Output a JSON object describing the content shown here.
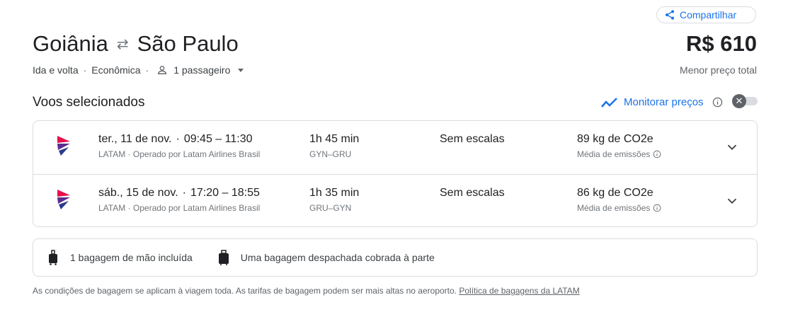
{
  "header": {
    "share_label": "Compartilhar",
    "origin": "Goiânia",
    "destination": "São Paulo",
    "price": "R$ 610",
    "price_subtitle": "Menor preço total",
    "trip_type": "Ida e volta",
    "cabin": "Econômica",
    "passengers": "1 passageiro"
  },
  "section": {
    "title": "Voos selecionados",
    "monitor_label": "Monitorar preços",
    "monitor_enabled": false
  },
  "flights": [
    {
      "date_time": "ter., 11 de nov.",
      "times": "09:45 – 11:30",
      "airline_line": "LATAM · Operado por Latam Airlines Brasil",
      "duration": "1h 45 min",
      "route": "GYN–GRU",
      "stops": "Sem escalas",
      "emissions": "89 kg de CO2e",
      "emissions_label": "Média de emissões"
    },
    {
      "date_time": "sáb., 15 de nov.",
      "times": "17:20 – 18:55",
      "airline_line": "LATAM · Operado por Latam Airlines Brasil",
      "duration": "1h 35 min",
      "route": "GRU–GYN",
      "stops": "Sem escalas",
      "emissions": "86 kg de CO2e",
      "emissions_label": "Média de emissões"
    }
  ],
  "baggage": {
    "carry_on": "1 bagagem de mão incluída",
    "checked": "Uma bagagem despachada cobrada à parte",
    "note": "As condições de bagagem se aplicam à viagem toda. As tarifas de bagagem podem ser mais altas no aeroporto.",
    "policy_link": "Política de bagagens da LATAM"
  },
  "colors": {
    "accent": "#1a73e8",
    "latam_purple": "#5c2d91",
    "latam_red": "#e8114b"
  },
  "icons": [
    "share-icon",
    "swap-arrows-icon",
    "person-icon",
    "caret-down-icon",
    "trend-icon",
    "info-icon",
    "close-icon",
    "latam-logo",
    "chevron-down-icon",
    "carry-on-bag-icon",
    "checked-bag-icon"
  ]
}
